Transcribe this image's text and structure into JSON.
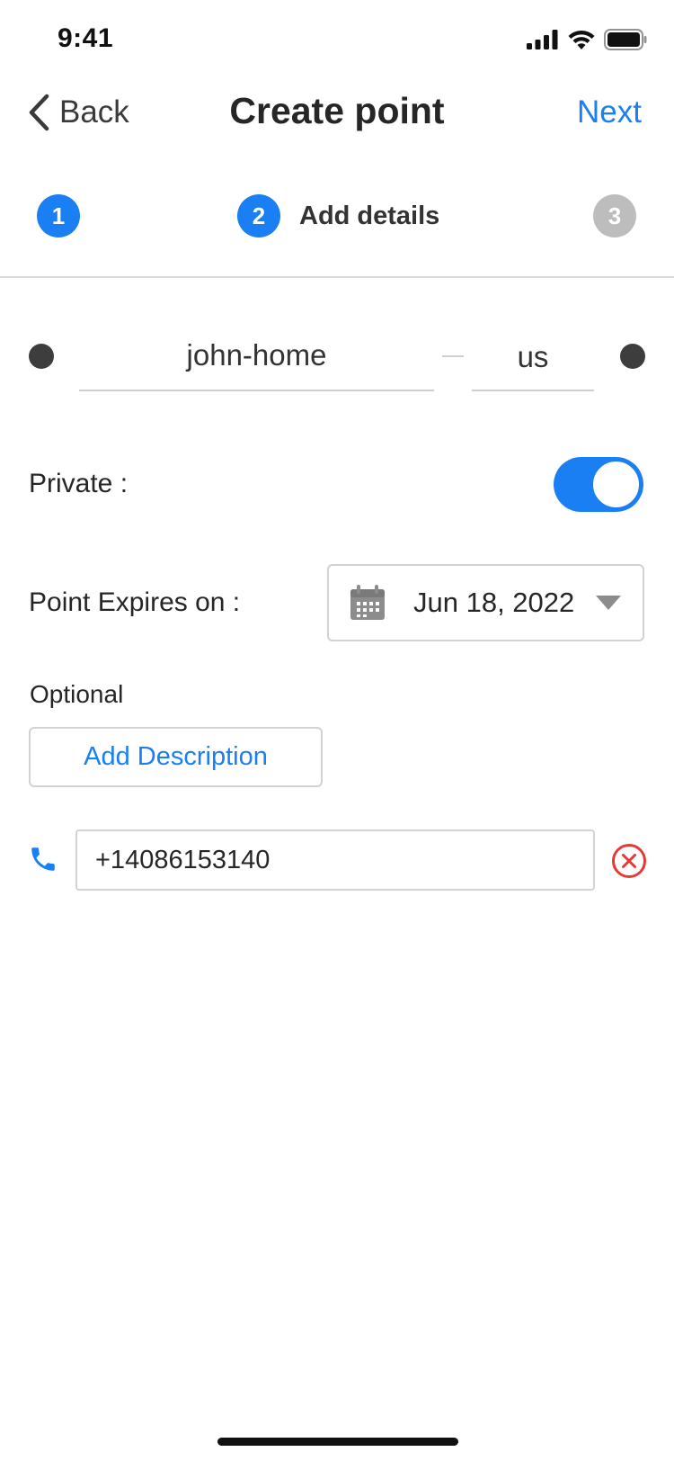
{
  "status_bar": {
    "time": "9:41",
    "icons": [
      "cellular-signal-icon",
      "wifi-icon",
      "battery-icon"
    ]
  },
  "nav": {
    "back_label": "Back",
    "title": "Create point",
    "next_label": "Next"
  },
  "stepper": {
    "steps": [
      {
        "number": "1",
        "label": "",
        "state": "completed"
      },
      {
        "number": "2",
        "label": "Add details",
        "state": "current"
      },
      {
        "number": "3",
        "label": "",
        "state": "upcoming"
      }
    ]
  },
  "point_name": {
    "first": "john-home",
    "second": "us"
  },
  "private": {
    "label": "Private :",
    "enabled": true
  },
  "expires": {
    "label": "Point Expires on :",
    "date": "Jun 18, 2022"
  },
  "optional": {
    "label": "Optional",
    "add_description_label": "Add Description"
  },
  "phone": {
    "value": "+14086153140"
  },
  "colors": {
    "accent": "#1a7ff3",
    "inactive_step": "#bdbdbd",
    "remove": "#e53935"
  }
}
